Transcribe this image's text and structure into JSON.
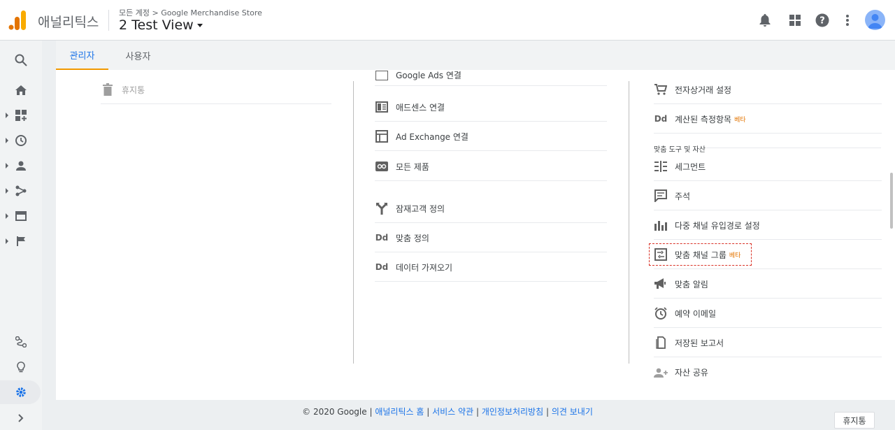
{
  "header": {
    "app_name": "애널리틱스",
    "breadcrumb_account": "모든 계정",
    "breadcrumb_sep": ">",
    "breadcrumb_property": "Google Merchandise Store",
    "view_name": "2 Test View"
  },
  "tabs": [
    {
      "label": "관리자",
      "active": true
    },
    {
      "label": "사용자",
      "active": false
    }
  ],
  "account_col": {
    "items": [
      {
        "label": "휴지통",
        "icon": "trash-icon"
      }
    ]
  },
  "property_col": {
    "items": [
      {
        "label": "Google Ads 연결",
        "icon": "google-ads-icon"
      },
      {
        "label": "애드센스 연결",
        "icon": "adsense-icon"
      },
      {
        "label": "Ad Exchange 연결",
        "icon": "ad-exchange-icon"
      },
      {
        "label": "모든 제품",
        "icon": "link-icon"
      },
      {
        "label": "잠재고객 정의",
        "icon": "audience-icon"
      },
      {
        "label": "맞춤 정의",
        "icon": "dd-icon"
      },
      {
        "label": "데이터 가져오기",
        "icon": "dd-icon"
      }
    ]
  },
  "view_col": {
    "items": [
      {
        "label": "전자상거래 설정",
        "icon": "cart-icon"
      },
      {
        "label": "계산된 측정항목",
        "icon": "dd-icon",
        "badge": "베타"
      }
    ],
    "section_label": "맞춤 도구 및 자산",
    "tools": [
      {
        "label": "세그먼트",
        "icon": "segment-icon"
      },
      {
        "label": "주석",
        "icon": "annotation-icon"
      },
      {
        "label": "다중 채널 유입경로 설정",
        "icon": "bar-chart-icon"
      },
      {
        "label": "맞춤 채널 그룹",
        "icon": "channel-group-icon",
        "badge": "베타"
      },
      {
        "label": "맞춤 알림",
        "icon": "megaphone-icon"
      },
      {
        "label": "예약 이메일",
        "icon": "alarm-icon"
      },
      {
        "label": "저장된 보고서",
        "icon": "report-icon"
      },
      {
        "label": "자산 공유",
        "icon": "share-user-icon"
      }
    ]
  },
  "footer": {
    "copyright": "© 2020 Google",
    "sep": "|",
    "links": [
      "애널리틱스 홈",
      "서비스 약관",
      "개인정보처리방침",
      "의견 보내기"
    ]
  },
  "trash_button": "휴지통",
  "colors": {
    "accent": "#1a73e8",
    "tab_underline": "#f29900",
    "beta": "#e37400",
    "highlight": "#d93025"
  }
}
